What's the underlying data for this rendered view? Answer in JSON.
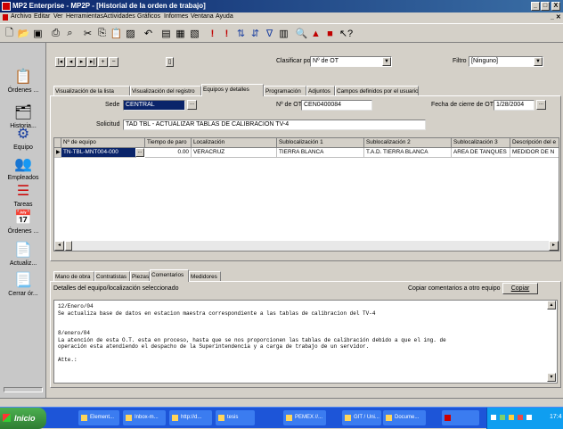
{
  "window": {
    "title": "MP2 Enterprise - MP2P - [Historial de la orden de trabajo]",
    "controls": [
      "_",
      "□",
      "X"
    ]
  },
  "menu": [
    "Archivo",
    "Editar",
    "Ver",
    "Herramientas",
    "Actividades",
    "Gráficos",
    "Informes",
    "Ventana",
    "Ayuda"
  ],
  "left_toolbar": [
    {
      "label": "Órdenes ...",
      "icon": "clipboard-icon"
    },
    {
      "label": "Historia...",
      "icon": "history-icon"
    },
    {
      "label": "Equipo",
      "icon": "equipment-icon"
    },
    {
      "label": "Empleados",
      "icon": "employees-icon"
    },
    {
      "label": "Tareas",
      "icon": "tasks-icon"
    },
    {
      "label": "Órdenes ...",
      "icon": "calendar-icon"
    },
    {
      "label": "Actualiz...",
      "icon": "update-icon"
    },
    {
      "label": "Cerrar ór...",
      "icon": "close-order-icon"
    }
  ],
  "nav": {
    "sort_label": "Clasificar por",
    "sort_value": "Nº de OT",
    "filter_label": "Filtro",
    "filter_value": "[Ninguno]"
  },
  "tabs": [
    "Visualización de la lista",
    "Visualización del registro",
    "Equipos y detalles",
    "Programación",
    "Adjuntos",
    "Campos definidos por el usuario"
  ],
  "active_tab": 2,
  "form": {
    "sede_label": "Sede",
    "sede_value": "CENTRAL",
    "ot_label": "Nº de OT",
    "ot_value": "CEN0400084",
    "fecha_label": "Fecha de cierre de OT",
    "fecha_value": "1/28/2004",
    "solicitud_label": "Solicitud",
    "solicitud_value": "TAD TBL - ACTUALIZAR TABLAS DE CALIBRACION TV-4"
  },
  "grid": {
    "columns": [
      "Nº de equipo",
      "Tiempo de paro",
      "Localización",
      "Sublocalización 1",
      "Sublocalización 2",
      "Sublocalización 3",
      "Descripción del e"
    ],
    "rows": [
      [
        "TN-TBL-MNT004-000",
        "0.00",
        "VERACRUZ",
        "TIERRA BLANCA",
        "T.A.D. TIERRA BLANCA",
        "AREA DE TANQUES",
        "MEDIDOR DE N"
      ]
    ]
  },
  "bottom_tabs": [
    "Mano de obra",
    "Contratistas",
    "Piezas",
    "Comentarios",
    "Medidores"
  ],
  "bottom_active": 3,
  "comments": {
    "header": "Detalles del equipo/localización seleccionado",
    "copy_label": "Copiar comentarios a otro equipo",
    "copy_button": "Copiar",
    "text": "12/Enero/04\nSe actualiza base de datos en estacion maestra correspondiente a las tablas de calibracion del TV-4\n\n\n8/enero/04\nLa atención de esta O.T. esta en proceso, hasta que se nos proporcionen las tablas de calibración debido a que el ing. de\noperación esta atendiendo el despacho de la Superintendencia y a carga de trabajo de un servidor.\n\nAtte.:"
  },
  "taskbar": {
    "start": "Inicio",
    "tasks": [
      "Element...",
      "Inbox-m...",
      "http://d...",
      "tesis",
      "PEMEX //...",
      "GIT / Uni...",
      "Docume..."
    ],
    "clock": "17:4"
  },
  "colors": {
    "title_gradient_start": "#0a246a",
    "title_gradient_end": "#3a6ea5",
    "taskbar": "#1d55d8",
    "start_button": "#3a9a3e",
    "selected_cell": "#0a246a"
  }
}
